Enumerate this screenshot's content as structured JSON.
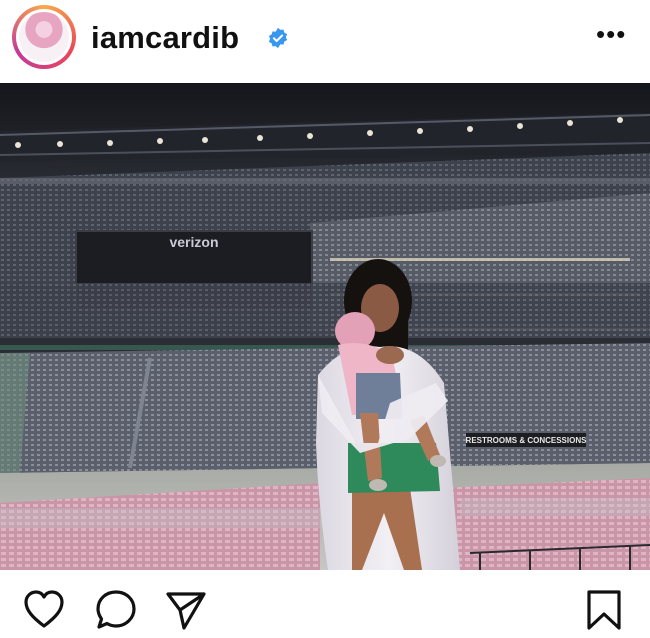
{
  "post": {
    "username": "iamcardib",
    "verified_icon": "verified-badge-icon",
    "menu_icon": "more-options-icon",
    "menu_glyph": "•••"
  },
  "photo": {
    "scoreboard_text": "verizon",
    "sign_text": "RESTROOMS & CONCESSIONS"
  },
  "actions": {
    "icons": [
      "heart-icon",
      "comment-icon",
      "share-icon",
      "bookmark-icon"
    ]
  },
  "colors": {
    "verified": "#3897f0",
    "text": "#111111",
    "seats_pink": "#d9a8b8"
  }
}
